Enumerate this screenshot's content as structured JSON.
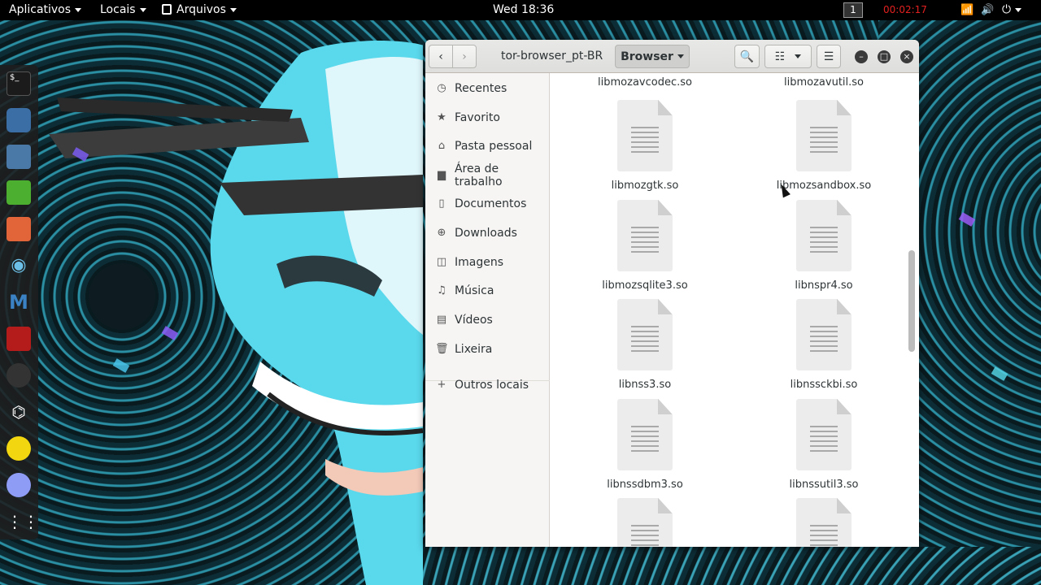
{
  "topbar": {
    "applications": "Aplicativos",
    "places": "Locais",
    "files_menu": "Arquivos",
    "clock": "Wed 18:36",
    "workspace": "1",
    "recording_timer": "00:02:17"
  },
  "dock": {
    "items": [
      "terminal-icon",
      "chromium-icon",
      "files-icon",
      "text-editor-icon",
      "burp-icon",
      "eye-icon",
      "metasploit-icon",
      "cherrytree-icon",
      "maltego-icon",
      "wireless-icon",
      "torch-icon",
      "media-player-icon",
      "app-grid-icon"
    ]
  },
  "window": {
    "location": "tor-browser_pt-BR",
    "path_button": "Browser",
    "colors": {
      "accent": "#2e3436",
      "header": "#e8e8e7",
      "sidebar": "#f6f5f4"
    }
  },
  "sidebar": {
    "items": [
      {
        "label": "Recentes",
        "icon": "clock-icon"
      },
      {
        "label": "Favorito",
        "icon": "star-icon"
      },
      {
        "label": "Pasta pessoal",
        "icon": "home-icon"
      },
      {
        "label": "Área de trabalho",
        "icon": "desktop-icon"
      },
      {
        "label": "Documentos",
        "icon": "document-icon"
      },
      {
        "label": "Downloads",
        "icon": "download-icon"
      },
      {
        "label": "Imagens",
        "icon": "image-icon"
      },
      {
        "label": "Música",
        "icon": "music-icon"
      },
      {
        "label": "Vídeos",
        "icon": "video-icon"
      },
      {
        "label": "Lixeira",
        "icon": "trash-icon"
      }
    ],
    "other": {
      "label": "Outros locais",
      "icon": "plus-icon"
    }
  },
  "files": [
    "libmozavcodec.so",
    "libmozavutil.so",
    "libmozgtk.so",
    "libmozsandbox.so",
    "libmozsqlite3.so",
    "libnspr4.so",
    "libnss3.so",
    "libnssckbi.so",
    "libnssdbm3.so",
    "libnssutil3.so"
  ]
}
